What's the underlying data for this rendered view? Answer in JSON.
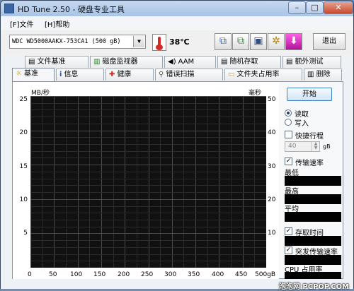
{
  "window": {
    "title": "HD Tune 2.50 - 硬盘专业工具"
  },
  "titlebar": {
    "minimize": "–",
    "maximize": "□",
    "close": "✕"
  },
  "menu": {
    "file": "[F]文件",
    "help": "[H]帮助"
  },
  "toolbar": {
    "drive": "WDC WD5000AAKX-753CA1 (500 gB)",
    "temperature": "38℃",
    "exit": "退出",
    "thermometer_icon": "thermometer-icon"
  },
  "tabs": {
    "row1": [
      {
        "label": "文件基准",
        "icon": "doc"
      },
      {
        "label": "磁盘监视器",
        "icon": "bars"
      },
      {
        "label": "AAM",
        "icon": "speaker"
      },
      {
        "label": "随机存取",
        "icon": "doc"
      },
      {
        "label": "额外测试",
        "icon": "doc"
      }
    ],
    "row2": [
      {
        "label": "基准",
        "icon": "bulb"
      },
      {
        "label": "信息",
        "icon": "info"
      },
      {
        "label": "健康",
        "icon": "cross"
      },
      {
        "label": "错误扫描",
        "icon": "magnifier"
      },
      {
        "label": "文件夹占用率",
        "icon": "folder"
      },
      {
        "label": "删除",
        "icon": "trash"
      }
    ]
  },
  "chart_data": {
    "type": "line",
    "ylabel_left": "MB/秒",
    "ylabel_right": "毫秒",
    "y_left_ticks": [
      "25",
      "20",
      "15",
      "10",
      "5"
    ],
    "y_right_ticks": [
      "50",
      "40",
      "30",
      "20",
      "10"
    ],
    "x_ticks": [
      "0",
      "50",
      "100",
      "150",
      "200",
      "250",
      "300",
      "350",
      "400",
      "450",
      "500gB"
    ],
    "ylim_left": [
      0,
      25
    ],
    "ylim_right": [
      0,
      50
    ],
    "xlim": [
      0,
      500
    ],
    "background": "#111111",
    "grid": true,
    "series": []
  },
  "side": {
    "start": "开始",
    "read": "读取",
    "write": "写入",
    "block_size_label": "快捷行程",
    "block_size_value": "40",
    "block_unit": "gB",
    "transfer_rate": "传输速率",
    "min": "最低",
    "max": "最高",
    "avg": "平均",
    "access_time": "存取时间",
    "burst_rate": "突发传输速率",
    "cpu_usage": "CPU 占用率",
    "check_mark": "✓"
  },
  "watermark": "泡泡网 PCPOP.COM"
}
